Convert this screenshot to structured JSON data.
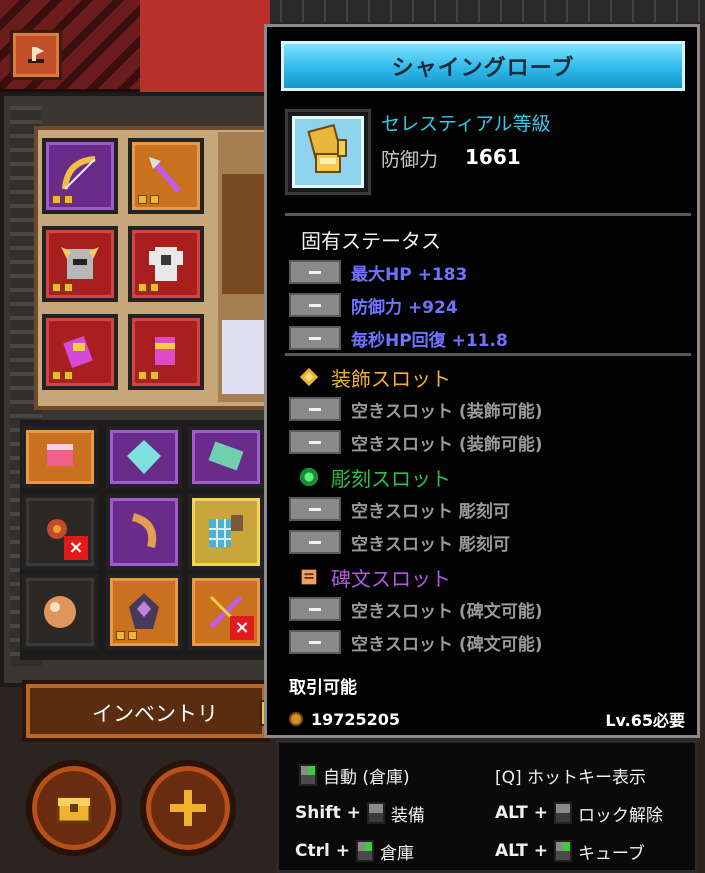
{
  "tooltip": {
    "title": "シャイングローブ",
    "grade": "セレスティアル等級",
    "defense_label": "防御力",
    "defense_value": "1661",
    "intrinsic_header": "固有ステータス",
    "stats": [
      "最大HP +183",
      "防御力 +924",
      "毎秒HP回復 +11.8"
    ],
    "accessory_header": "装飾スロット",
    "accessory_slots": [
      "空きスロット (装飾可能)",
      "空きスロット (装飾可能)"
    ],
    "engrave_header": "彫刻スロット",
    "engrave_slots": [
      "空きスロット 彫刻可",
      "空きスロット 彫刻可"
    ],
    "rune_header": "碑文スロット",
    "rune_slots": [
      "空きスロット (碑文可能)",
      "空きスロット (碑文可能)"
    ],
    "tradable": "取引可能",
    "gold": "19725205",
    "required_level": "Lv.65必要",
    "colors": {
      "grade": "#38c7e6",
      "stat": "#6f73ff",
      "accessory": "#f0b030",
      "engrave": "#2fbf4a",
      "rune": "#b05ae0"
    }
  },
  "hints": {
    "auto": "自動 (倉庫)",
    "hotkey": "[Q] ホットキー表示",
    "shift": "Shift +",
    "equip": "装備",
    "alt": "ALT +",
    "unlock": "ロック解除",
    "ctrl": "Ctrl +",
    "storage": "倉庫",
    "cube": "キューブ"
  },
  "inventory": {
    "button_label": "インベントリ"
  },
  "icons": {
    "back": "back-arrow-icon",
    "item": "gauntlet-icon",
    "accessory": "diamond-icon",
    "engrave": "green-orb-icon",
    "rune": "scroll-icon",
    "chest": "chest-icon",
    "cross": "cross-icon"
  }
}
